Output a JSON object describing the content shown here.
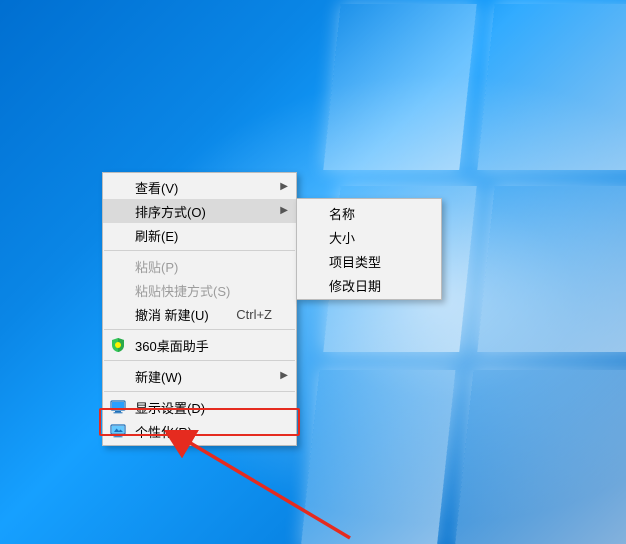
{
  "mainMenu": {
    "view": {
      "label": "查看(V)"
    },
    "sort": {
      "label": "排序方式(O)"
    },
    "refresh": {
      "label": "刷新(E)"
    },
    "paste": {
      "label": "粘贴(P)"
    },
    "pasteShortcut": {
      "label": "粘贴快捷方式(S)"
    },
    "undo": {
      "label": "撤消 新建(U)",
      "shortcut": "Ctrl+Z"
    },
    "deskHelper": {
      "label": "360桌面助手"
    },
    "new": {
      "label": "新建(W)"
    },
    "display": {
      "label": "显示设置(D)"
    },
    "personalize": {
      "label": "个性化(R)"
    }
  },
  "subMenu": {
    "name": {
      "label": "名称"
    },
    "size": {
      "label": "大小"
    },
    "type": {
      "label": "项目类型"
    },
    "date": {
      "label": "修改日期"
    }
  },
  "colors": {
    "accent": "#0078d7",
    "annotation": "#e52b1f"
  }
}
